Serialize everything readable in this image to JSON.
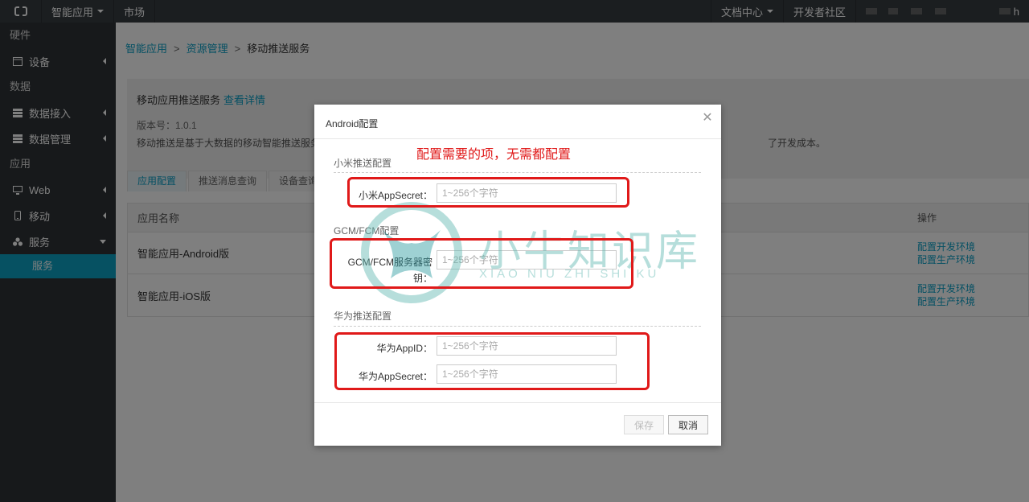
{
  "topbar": {
    "product_menu": "智能应用",
    "market": "市场",
    "docs": "文档中心",
    "community": "开发者社区",
    "user_suffix": "h"
  },
  "sidebar": {
    "groups": [
      {
        "title": "硬件",
        "items": [
          {
            "label": "设备",
            "icon": "device-icon"
          }
        ]
      },
      {
        "title": "数据",
        "items": [
          {
            "label": "数据接入",
            "icon": "data-import-icon"
          },
          {
            "label": "数据管理",
            "icon": "data-manage-icon"
          }
        ]
      },
      {
        "title": "应用",
        "items": [
          {
            "label": "Web",
            "icon": "monitor-icon"
          },
          {
            "label": "移动",
            "icon": "mobile-icon"
          },
          {
            "label": "服务",
            "icon": "service-icon"
          }
        ]
      }
    ],
    "active_sub": "服务"
  },
  "breadcrumb": [
    "智能应用",
    "资源管理",
    "移动推送服务"
  ],
  "info": {
    "title": "移动应用推送服务",
    "detail_link": "查看详情",
    "version": "版本号：1.0.1",
    "description": "移动推送是基于大数据的移动智能推送服务",
    "description_tail": "了开发成本。"
  },
  "tabs": [
    "应用配置",
    "推送消息查询",
    "设备查询"
  ],
  "table": {
    "headers": [
      "应用名称",
      "操作"
    ],
    "rows": [
      {
        "name": "智能应用-Android版",
        "ops": [
          "配置开发环境",
          "配置生产环境"
        ]
      },
      {
        "name": "智能应用-iOS版",
        "ops": [
          "配置开发环境",
          "配置生产环境"
        ]
      }
    ]
  },
  "dialog": {
    "title": "Android配置",
    "sections": [
      {
        "title": "小米推送配置",
        "fields": [
          {
            "label": "小米AppSecret：",
            "placeholder": "1~256个字符"
          }
        ]
      },
      {
        "title": "GCM/FCM配置",
        "fields": [
          {
            "label": "GCM/FCM服务器密钥：",
            "placeholder": "1~256个字符"
          }
        ]
      },
      {
        "title": "华为推送配置",
        "fields": [
          {
            "label": "华为AppID：",
            "placeholder": "1~256个字符"
          },
          {
            "label": "华为AppSecret：",
            "placeholder": "1~256个字符"
          }
        ]
      }
    ],
    "save": "保存",
    "cancel": "取消"
  },
  "annotation": "配置需要的项，无需都配置",
  "watermark": {
    "title": "小牛知识库",
    "subtitle": "XIAO NIU ZHI SHI KU"
  },
  "colors": {
    "accent": "#0ba0c7",
    "annotation": "#e01919",
    "sidebar": "#2f3337",
    "topbar": "#373d41"
  }
}
